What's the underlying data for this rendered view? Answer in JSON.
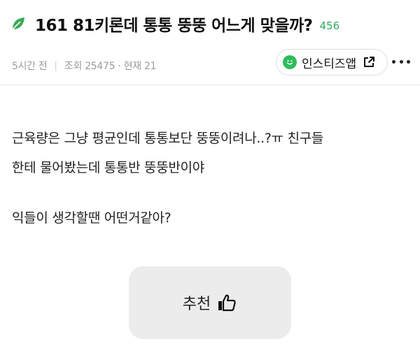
{
  "post": {
    "title": "161 81키론데 통통 뚱뚱 어느게 맞을까?",
    "comment_count": "456",
    "time_ago": "5시간 전",
    "views": "조회 25475 · 현재 21",
    "body": [
      "근육량은 그냥 평균인데 통통보단 뚱뚱이려나..?ㅠ 친구들",
      "한테 물어봤는데 통통반 뚱뚱반이야",
      "익들이 생각할땐 어떤거같아?"
    ]
  },
  "app_button": {
    "label": "인스티즈앱"
  },
  "recommend": {
    "label": "추천"
  },
  "colors": {
    "accent_green": "#2eaa5c",
    "leaf_green": "#2ebd5c",
    "button_gray": "#ececec"
  },
  "icons": [
    "leaf-icon",
    "smile-icon",
    "external-link-icon",
    "more-icon",
    "thumbs-up-icon"
  ]
}
